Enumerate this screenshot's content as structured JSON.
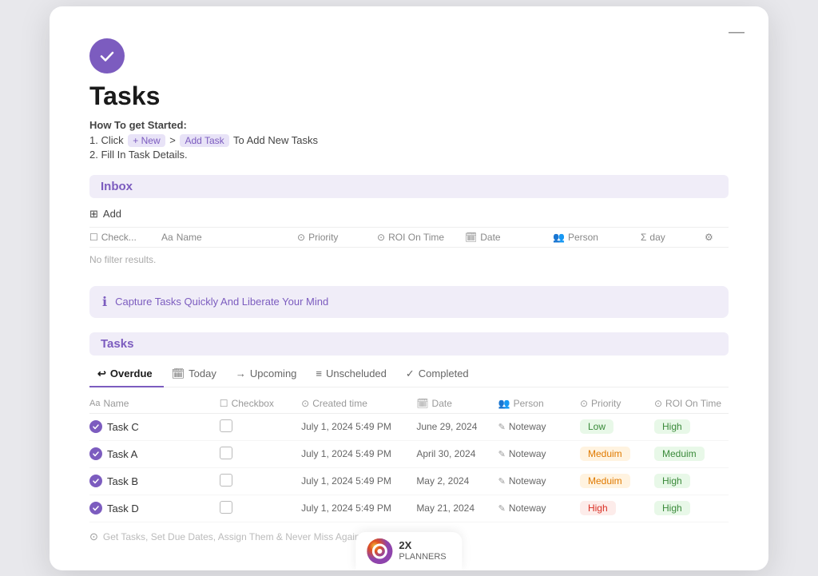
{
  "window": {
    "minimize": "—"
  },
  "header": {
    "title": "Tasks",
    "how_to_label": "How To get Started:",
    "steps": [
      {
        "num": "1.",
        "prefix": "Click",
        "badge1": "+ New",
        "arrow": ">",
        "badge2": "Add Task",
        "suffix": "To Add New Tasks"
      },
      {
        "num": "2.",
        "text": "Fill In Task Details."
      }
    ]
  },
  "inbox": {
    "title": "Inbox",
    "add_label": "Add",
    "columns": {
      "check": "Check...",
      "name": "Name",
      "priority": "Priority",
      "roi": "ROI On Time",
      "date": "Date",
      "person": "Person",
      "day": "day"
    },
    "no_filter": "No filter results."
  },
  "banner": {
    "text": "Capture Tasks Quickly And Liberate Your Mind"
  },
  "tasks": {
    "title": "Tasks",
    "tabs": [
      {
        "label": "Overdue",
        "icon": "↩",
        "active": true
      },
      {
        "label": "Today",
        "icon": "📅",
        "active": false
      },
      {
        "label": "Upcoming",
        "icon": "→",
        "active": false
      },
      {
        "label": "Unscheluded",
        "icon": "≡",
        "active": false
      },
      {
        "label": "Completed",
        "icon": "✓",
        "active": false
      }
    ],
    "columns": {
      "name": "Name",
      "checkbox": "Checkbox",
      "created": "Created time",
      "date": "Date",
      "person": "Person",
      "priority": "Priority",
      "roi": "ROI On Time"
    },
    "rows": [
      {
        "name": "Task C",
        "created": "July 1, 2024 5:49 PM",
        "date": "June 29, 2024",
        "person": "Noteway",
        "priority": "Low",
        "priority_class": "low",
        "roi": "High",
        "roi_class": "high"
      },
      {
        "name": "Task A",
        "created": "July 1, 2024 5:49 PM",
        "date": "April 30, 2024",
        "person": "Noteway",
        "priority": "Meduim",
        "priority_class": "medium",
        "roi": "Meduim",
        "roi_class": "medium"
      },
      {
        "name": "Task B",
        "created": "July 1, 2024 5:49 PM",
        "date": "May 2, 2024",
        "person": "Noteway",
        "priority": "Meduim",
        "priority_class": "medium",
        "roi": "High",
        "roi_class": "high"
      },
      {
        "name": "Task D",
        "created": "July 1, 2024 5:49 PM",
        "date": "May 21, 2024",
        "person": "Noteway",
        "priority": "High",
        "priority_class": "high",
        "roi": "High",
        "roi_class": "high"
      }
    ]
  },
  "branding": {
    "logo": "2X",
    "line1": "2X",
    "line2": "PLANNERS"
  }
}
